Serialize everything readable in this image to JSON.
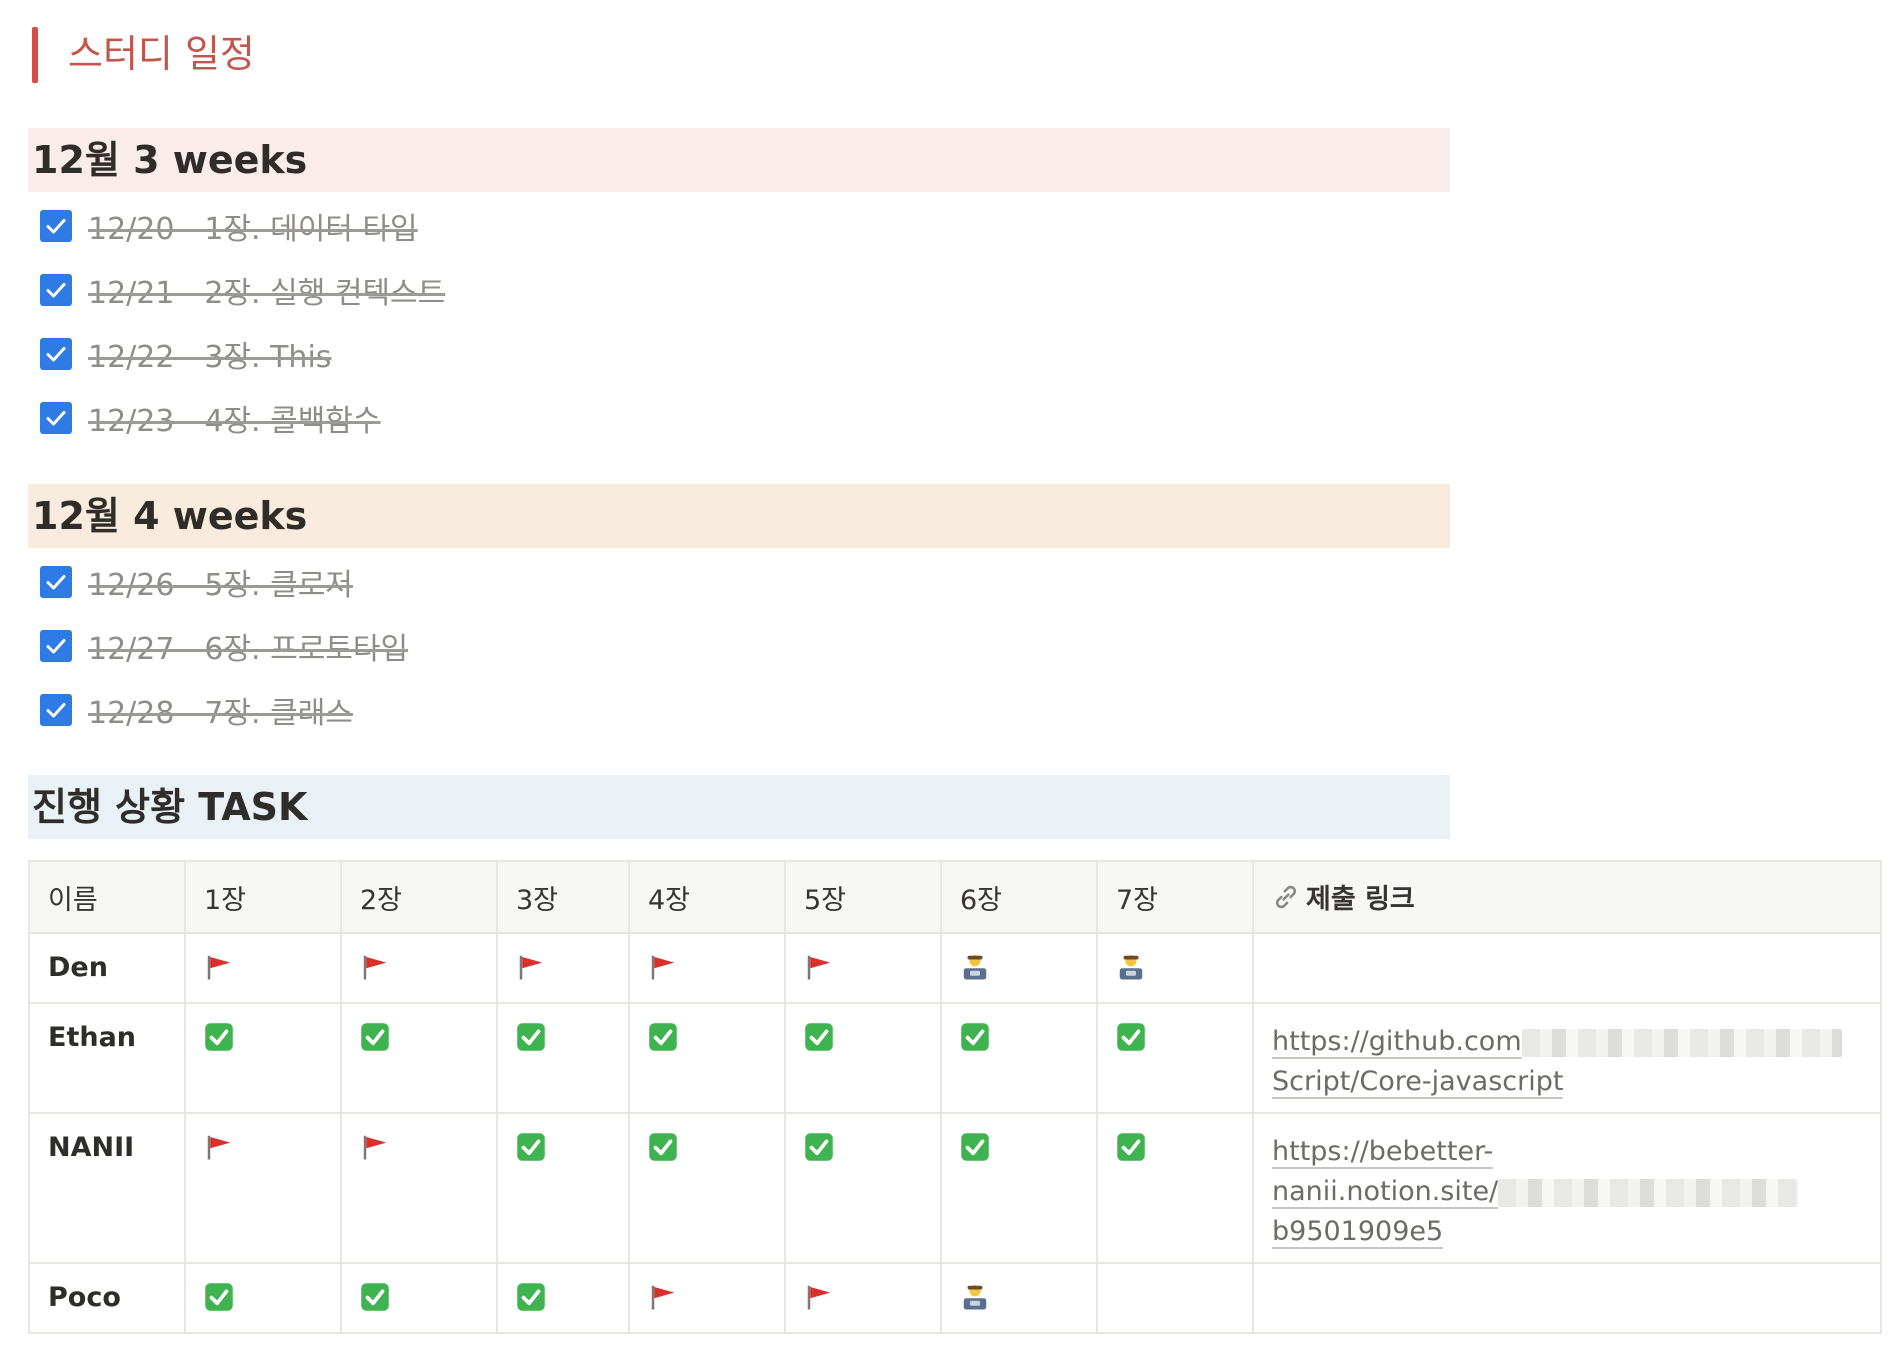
{
  "page": {
    "title": "스터디 일정"
  },
  "sections": [
    {
      "heading": "12월 3 weeks",
      "todos": [
        {
          "text": "12/20 - 1장. 데이터 타입",
          "checked": true
        },
        {
          "text": "12/21 - 2장. 실행 컨텍스트",
          "checked": true
        },
        {
          "text": "12/22 - 3장. This",
          "checked": true
        },
        {
          "text": "12/23 - 4장. 콜백함수",
          "checked": true
        }
      ]
    },
    {
      "heading": "12월 4 weeks",
      "todos": [
        {
          "text": "12/26 - 5장. 클로저",
          "checked": true
        },
        {
          "text": "12/27 - 6장. 프로토타입",
          "checked": true
        },
        {
          "text": "12/28 - 7장. 클래스",
          "checked": true
        }
      ]
    },
    {
      "heading": "진행 상황 TASK"
    }
  ],
  "table": {
    "headers": [
      "이름",
      "1장",
      "2장",
      "3장",
      "4장",
      "5장",
      "6장",
      "7장",
      "제출 링크"
    ],
    "link_header_icon": "link-icon",
    "rows": [
      {
        "name": "Den",
        "status": [
          "flag",
          "flag",
          "flag",
          "flag",
          "flag",
          "coder",
          "coder"
        ],
        "link": ""
      },
      {
        "name": "Ethan",
        "status": [
          "check",
          "check",
          "check",
          "check",
          "check",
          "check",
          "check"
        ],
        "link_parts": [
          "https://github.com",
          "Script/Core-javascript"
        ]
      },
      {
        "name": "NANII",
        "status": [
          "flag",
          "flag",
          "check",
          "check",
          "check",
          "check",
          "check"
        ],
        "link_parts": [
          "https://bebetter-",
          "nanii.notion.site/",
          "b9501909e5"
        ]
      },
      {
        "name": "Poco",
        "status": [
          "check",
          "check",
          "check",
          "flag",
          "flag",
          "coder",
          ""
        ],
        "link": ""
      }
    ]
  },
  "colors": {
    "title_accent": "#d44c47",
    "heading_red_bg": "#fbecec",
    "heading_orange_bg": "#f9ebdd",
    "heading_blue_bg": "#e9f1f6",
    "checkbox_blue": "#2e7be6",
    "check_green": "#3fb34f",
    "flag_red": "#d9302c"
  }
}
